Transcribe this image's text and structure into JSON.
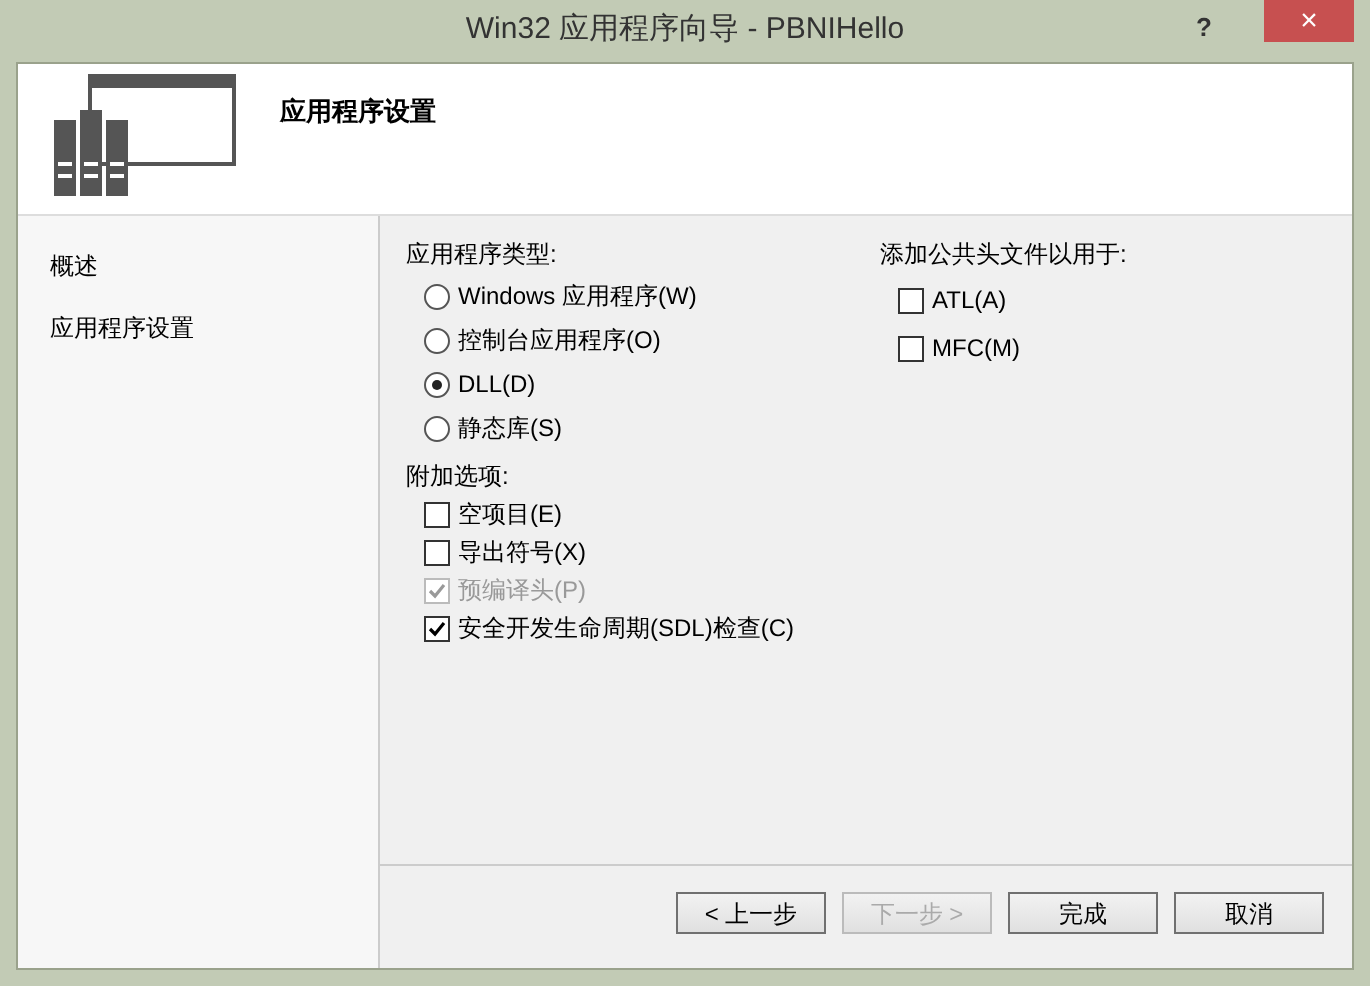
{
  "window": {
    "title": "Win32 应用程序向导 - PBNIHello",
    "help": "?",
    "close": "×"
  },
  "header": {
    "title": "应用程序设置"
  },
  "sidebar": {
    "items": [
      {
        "label": "概述"
      },
      {
        "label": "应用程序设置"
      }
    ]
  },
  "app_type": {
    "label": "应用程序类型:",
    "options": [
      {
        "label": "Windows 应用程序(W)",
        "selected": false
      },
      {
        "label": "控制台应用程序(O)",
        "selected": false
      },
      {
        "label": "DLL(D)",
        "selected": true
      },
      {
        "label": "静态库(S)",
        "selected": false
      }
    ]
  },
  "extra": {
    "label": "附加选项:",
    "options": [
      {
        "label": "空项目(E)",
        "checked": false,
        "disabled": false
      },
      {
        "label": "导出符号(X)",
        "checked": false,
        "disabled": false
      },
      {
        "label": "预编译头(P)",
        "checked": true,
        "disabled": true
      },
      {
        "label": "安全开发生命周期(SDL)检查(C)",
        "checked": true,
        "disabled": false
      }
    ]
  },
  "headers": {
    "label": "添加公共头文件以用于:",
    "options": [
      {
        "label": "ATL(A)",
        "checked": false
      },
      {
        "label": "MFC(M)",
        "checked": false
      }
    ]
  },
  "buttons": [
    {
      "label": "< 上一步",
      "disabled": false
    },
    {
      "label": "下一步 >",
      "disabled": true
    },
    {
      "label": "完成",
      "disabled": false
    },
    {
      "label": "取消",
      "disabled": false
    }
  ]
}
